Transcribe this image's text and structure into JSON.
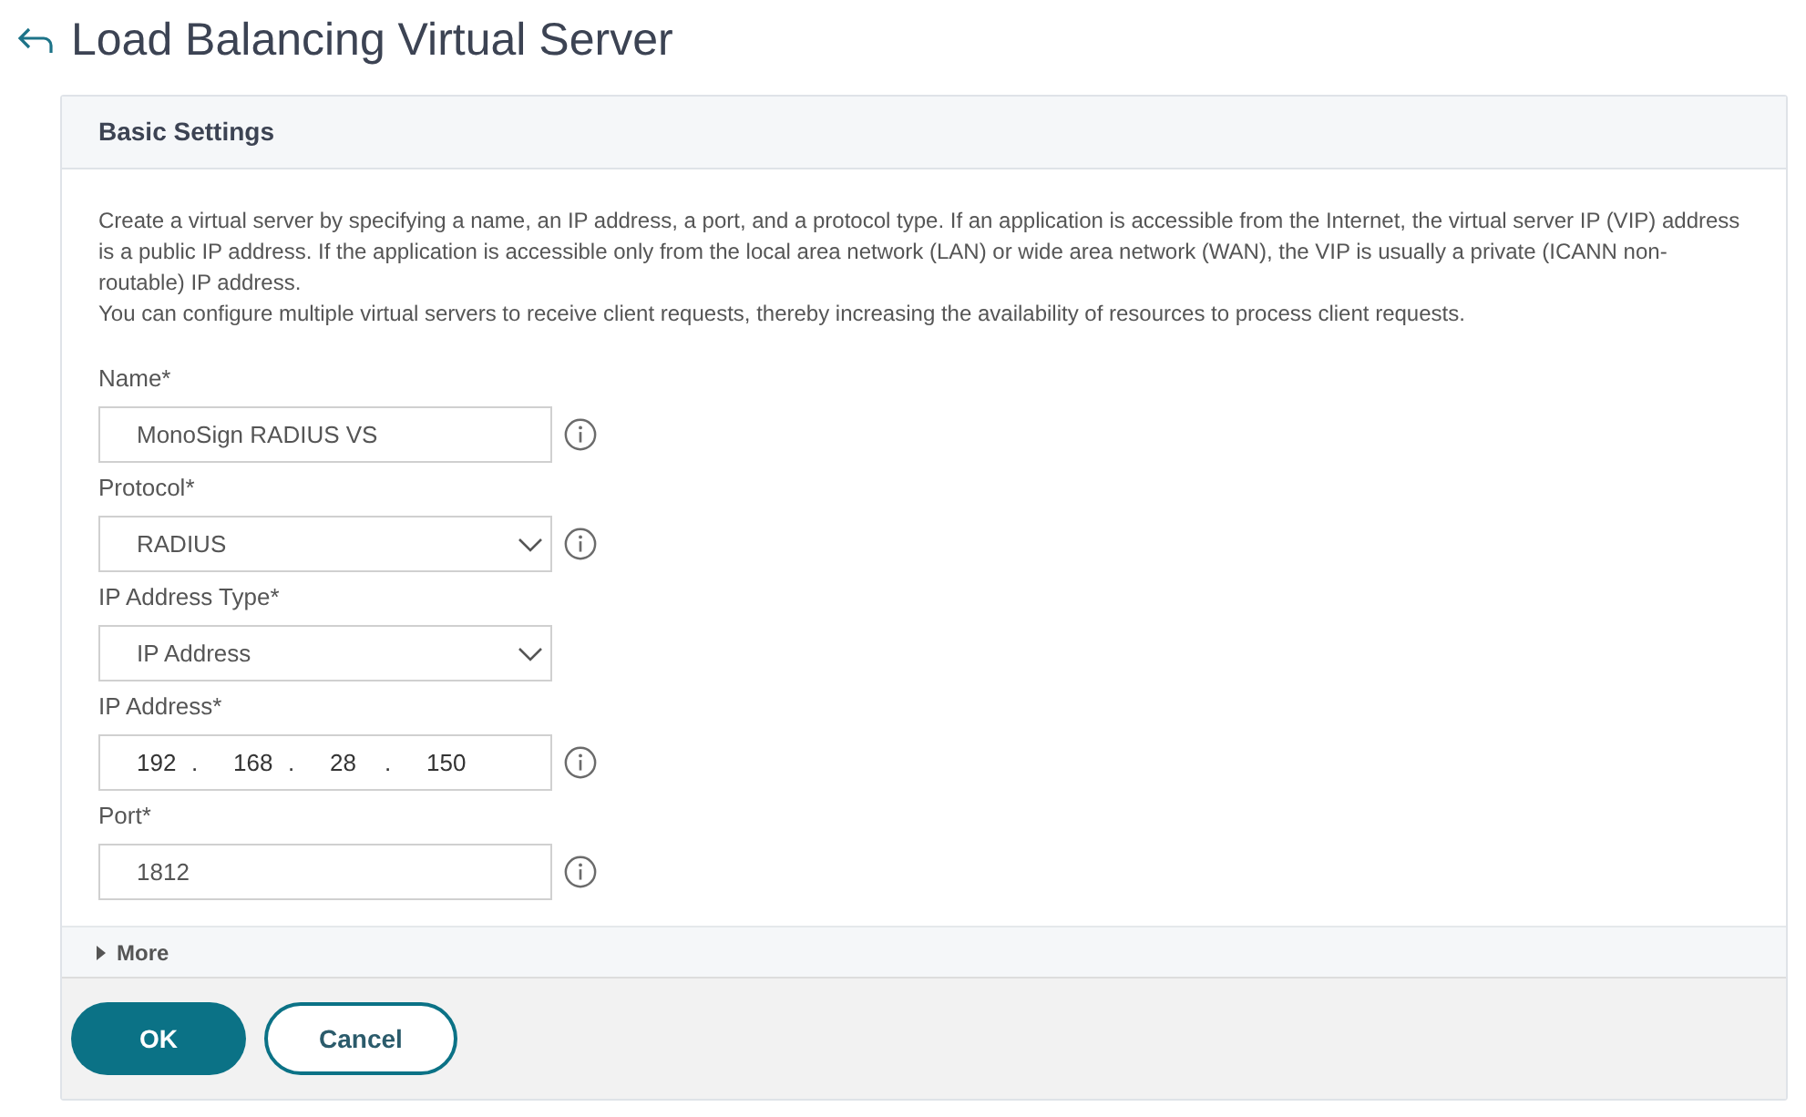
{
  "page": {
    "title": "Load Balancing Virtual Server"
  },
  "section": {
    "title": "Basic Settings",
    "description": [
      "Create a virtual server by specifying a name, an IP address, a port, and a protocol type. If an application is accessible from the Internet, the virtual server IP (VIP) address is a public IP address. If the application is accessible only from the local area network (LAN) or wide area network (WAN), the VIP is usually a private (ICANN non-routable) IP address.",
      "You can configure multiple virtual servers to receive client requests, thereby increasing the availability of resources to process client requests."
    ],
    "fields": [
      {
        "kind": "text",
        "label": "Name*",
        "value": "MonoSign RADIUS VS",
        "info": true
      },
      {
        "kind": "select",
        "label": "Protocol*",
        "value": "RADIUS",
        "info": true
      },
      {
        "kind": "select",
        "label": "IP Address Type*",
        "value": "IP Address",
        "info": false
      },
      {
        "kind": "ip",
        "label": "IP Address*",
        "octets": [
          "192",
          "168",
          "28",
          "150"
        ],
        "dots": [
          ".",
          ".",
          "."
        ],
        "info": true
      },
      {
        "kind": "text",
        "label": "Port*",
        "value": "1812",
        "info": true
      }
    ],
    "more": {
      "label": "More",
      "expanded": false
    }
  },
  "buttons": [
    {
      "kind": "primary",
      "label": "OK"
    },
    {
      "kind": "secondary",
      "label": "Cancel"
    }
  ]
}
